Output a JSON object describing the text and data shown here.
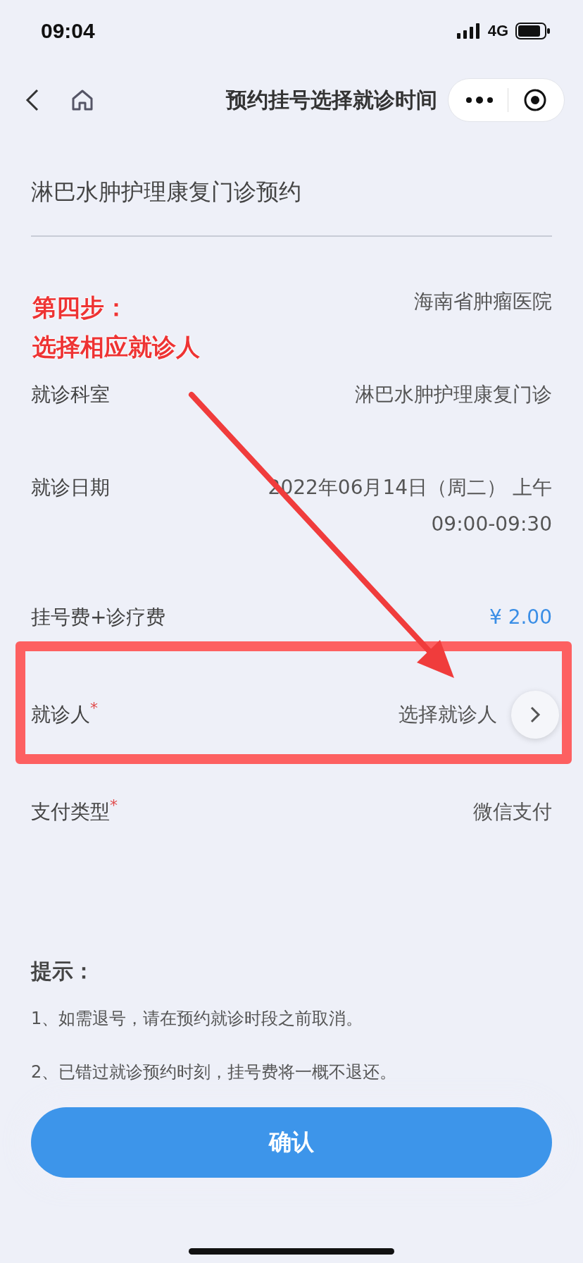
{
  "status_bar": {
    "time": "09:04",
    "network": "4G"
  },
  "nav": {
    "title": "预约挂号选择就诊时间"
  },
  "clinic_title": "淋巴水肿护理康复门诊预约",
  "fields": [
    {
      "kind": "text",
      "value": "海南省肿瘤医院"
    },
    {
      "kind": "text",
      "label": "就诊科室",
      "value": "淋巴水肿护理康复门诊"
    },
    {
      "kind": "text",
      "label": "就诊日期",
      "value": "2022年06月14日（周二） 上午",
      "value_2": "09:00-09:30"
    },
    {
      "kind": "price",
      "label": "挂号费+诊疗费",
      "value": "¥ 2.00"
    },
    {
      "kind": "select",
      "label": "就诊人",
      "placeholder": "选择就诊人",
      "required_mark": "*"
    },
    {
      "kind": "text",
      "label": "支付类型",
      "value": "微信支付",
      "required_mark": "*"
    }
  ],
  "tips": {
    "title": "提示：",
    "items": [
      "1、如需退号，请在预约就诊时段之前取消。",
      "2、已错过就诊预约时刻，挂号费将一概不退还。"
    ]
  },
  "confirm_button": "确认",
  "annotation": {
    "lines": [
      "第四步：",
      "选择相应就诊人"
    ]
  }
}
